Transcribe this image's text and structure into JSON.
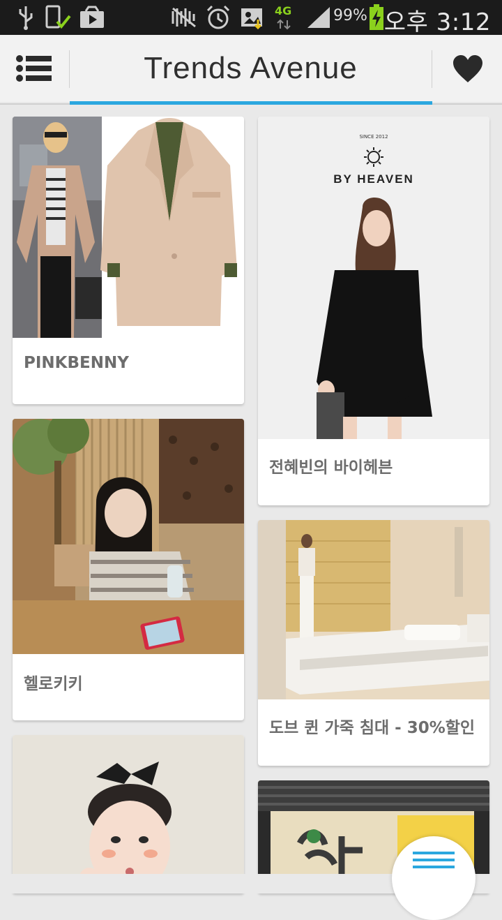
{
  "status_bar": {
    "network": "4G",
    "battery": "99%",
    "time": "오후 3:12",
    "icons": [
      "usb-icon",
      "phone-check-icon",
      "play-store-icon",
      "mute-icon",
      "alarm-icon",
      "photo-icon",
      "signal-icon",
      "battery-charging-icon"
    ]
  },
  "header": {
    "title": "Trends Avenue",
    "menu_icon": "list-menu-icon",
    "favorite_icon": "heart-icon",
    "accent_color": "#2ba7df"
  },
  "cards": [
    {
      "label": "PINKBENNY"
    },
    {
      "label": "전혜빈의 바이헤븐",
      "brand_small": "SINCE 2012",
      "brand_name": "BY HEAVEN"
    },
    {
      "label": "헬로키키"
    },
    {
      "label": "도브 퀸 가죽 침대 - 30%할인"
    },
    {
      "label": ""
    },
    {
      "label": ""
    }
  ],
  "fab": {
    "icon": "scroll-menu-icon"
  }
}
